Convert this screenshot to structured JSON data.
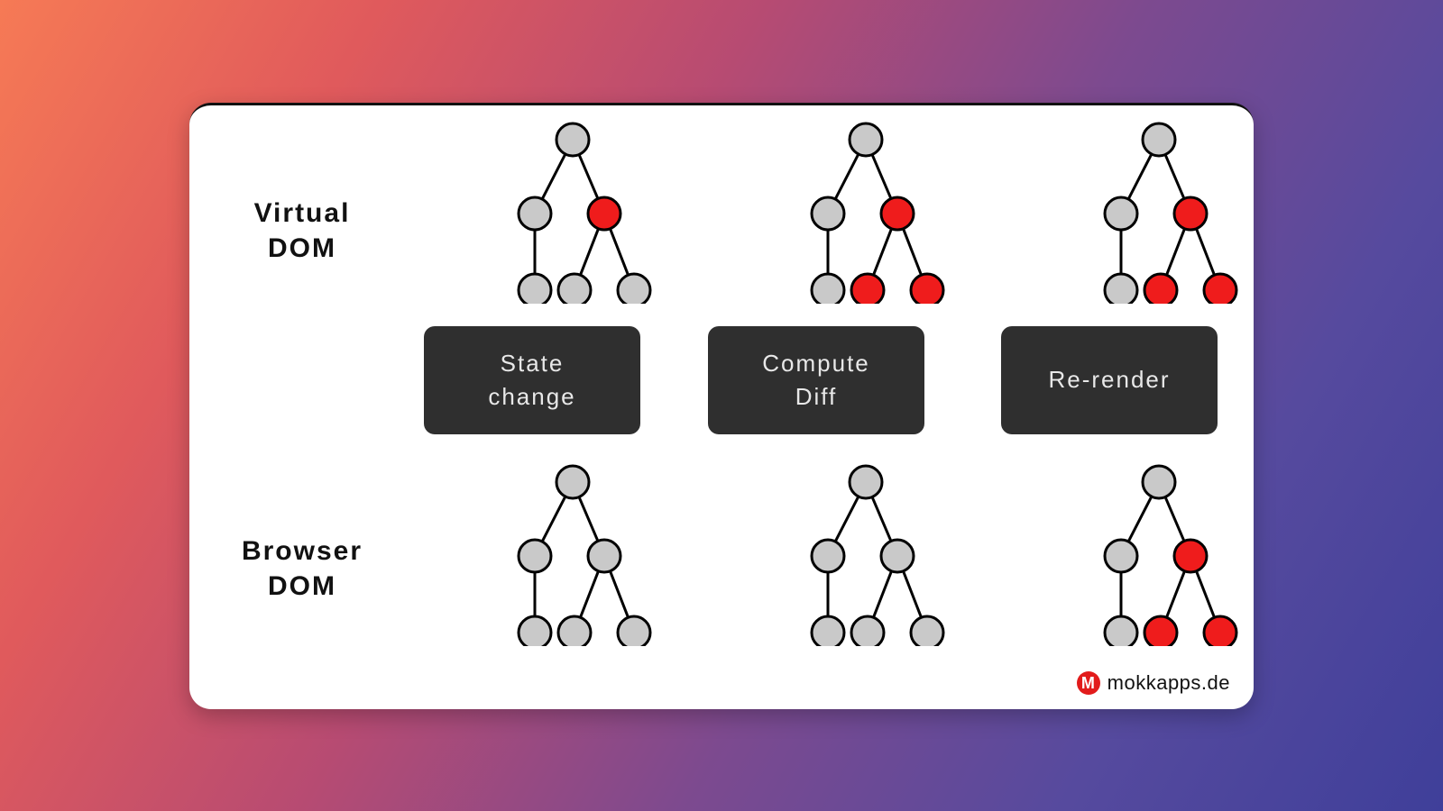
{
  "labels": {
    "virtual_line1": "Virtual",
    "virtual_line2": "DOM",
    "browser_line1": "Browser",
    "browser_line2": "DOM"
  },
  "steps": {
    "s1": "State\nchange",
    "s2": "Compute\nDiff",
    "s3": "Re-render"
  },
  "colors": {
    "node_gray": "#c9c9c9",
    "node_red": "#ef1c1c",
    "edge": "#000000",
    "step_bg": "#2f2f2f"
  },
  "trees": {
    "virtual": [
      {
        "highlighted": [
          "right"
        ]
      },
      {
        "highlighted": [
          "right",
          "right-left",
          "right-right"
        ]
      },
      {
        "highlighted": [
          "right",
          "right-left",
          "right-right"
        ]
      }
    ],
    "browser": [
      {
        "highlighted": []
      },
      {
        "highlighted": []
      },
      {
        "highlighted": [
          "right",
          "right-left",
          "right-right"
        ]
      }
    ]
  },
  "attribution": {
    "text": "mokkapps.de",
    "logo_letter": "M"
  }
}
